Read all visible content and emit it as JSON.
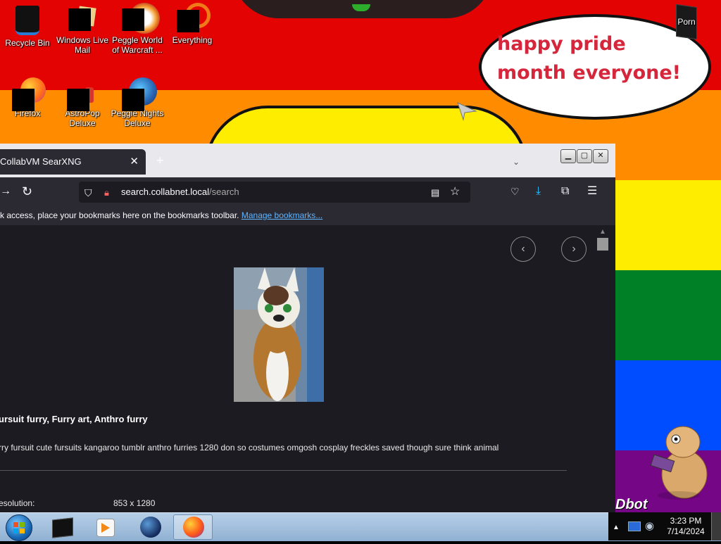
{
  "wallpaper": {
    "bubble_text": "happy pride month everyone!",
    "bottom_text": "Dbot"
  },
  "desktop": {
    "icons": [
      {
        "label": "Recycle Bin",
        "icon": "recycle-bin-icon"
      },
      {
        "label": "Windows Live Mail",
        "icon": "windows-live-mail-icon"
      },
      {
        "label": "Peggle World of Warcraft ...",
        "icon": "peggle-wow-icon"
      },
      {
        "label": "Everything",
        "icon": "everything-icon"
      },
      {
        "label": "Porn",
        "icon": "folder-icon"
      },
      {
        "label": "Firefox",
        "icon": "firefox-icon"
      },
      {
        "label": "AstroPop Deluxe",
        "icon": "astropop-icon"
      },
      {
        "label": "Peggle Nights Deluxe",
        "icon": "peggle-nights-icon"
      }
    ]
  },
  "browser": {
    "tab_title": "CollabVM SearXNG",
    "url_host": "search.collabnet.local",
    "url_path": "/search",
    "bookmarks_text": "k access, place your bookmarks here on the bookmarks toolbar.",
    "bookmarks_link": "Manage bookmarks..."
  },
  "result": {
    "title": "ursuit furry, Furry art, Anthro furry",
    "description": "rry fursuit cute fursuits kangaroo tumblr anthro furries 1280 don so costumes omgosh cosplay freckles saved though sure think animal",
    "resolution_label": "esolution:",
    "resolution_value": "853 x 1280"
  },
  "taskbar": {
    "items": [
      "start-orb",
      "cmd-window",
      "media-player",
      "world-globe",
      "firefox"
    ],
    "time": "3:23 PM",
    "date": "7/14/2024"
  }
}
